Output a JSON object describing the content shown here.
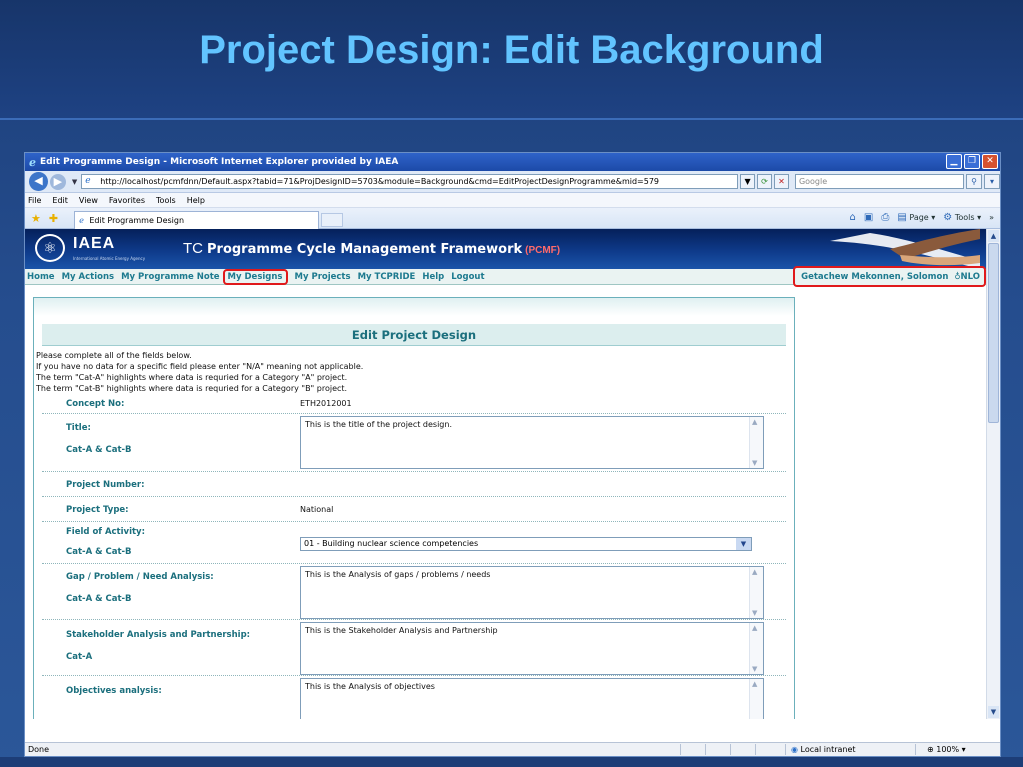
{
  "slide": {
    "title": "Project Design: Edit Background"
  },
  "window": {
    "title": "Edit Programme Design - Microsoft Internet Explorer provided by IAEA",
    "url": "http://localhost/pcmfdnn/Default.aspx?tabid=71&ProjDesignID=5703&module=Background&cmd=EditProjectDesignProgramme&mid=579",
    "search_placeholder": "Google",
    "menu": [
      "File",
      "Edit",
      "View",
      "Favorites",
      "Tools",
      "Help"
    ],
    "tab_label": "Edit Programme Design",
    "cmd_page": "Page",
    "cmd_tools": "Tools",
    "status_text": "Done",
    "zone_text": "Local intranet",
    "zoom_text": "100%"
  },
  "site": {
    "logo_text": "IAEA",
    "logo_sub": "International Atomic Energy Agency",
    "title_prefix": "TC",
    "title_main": "Programme Cycle Management Framework",
    "title_abbr": "(PCMF)",
    "nav": [
      "Home",
      "My Actions",
      "My Programme Note",
      "My Designs",
      "My Projects",
      "My TCPRIDE",
      "Help",
      "Logout"
    ],
    "user": "Getachew Mekonnen, Solomon",
    "role": "NLO"
  },
  "form": {
    "heading": "Edit Project Design",
    "instructions": [
      "Please complete all of the fields below.",
      "If you have no data for a specific field please enter \"N/A\" meaning not applicable.",
      "The term \"Cat-A\" highlights where data is requried for a Category \"A\" project.",
      "The term \"Cat-B\" highlights where data is requried for a Category \"B\" project."
    ],
    "concept_no_label": "Concept No:",
    "concept_no_value": "ETH2012001",
    "title_label": "Title:",
    "title_cat": "Cat-A & Cat-B",
    "title_value": "This is the title of the project design.",
    "project_number_label": "Project Number:",
    "project_type_label": "Project Type:",
    "project_type_value": "National",
    "field_label": "Field of Activity:",
    "field_cat": "Cat-A & Cat-B",
    "field_value": "01 - Building nuclear science competencies",
    "gap_label": "Gap / Problem / Need Analysis:",
    "gap_cat": "Cat-A & Cat-B",
    "gap_value": "This is the Analysis of gaps / problems / needs",
    "stake_label": "Stakeholder Analysis and Partnership:",
    "stake_cat": "Cat-A",
    "stake_value": "This is the Stakeholder Analysis and Partnership",
    "obj_label": "Objectives analysis:",
    "obj_value": "This is the Analysis of objectives"
  }
}
